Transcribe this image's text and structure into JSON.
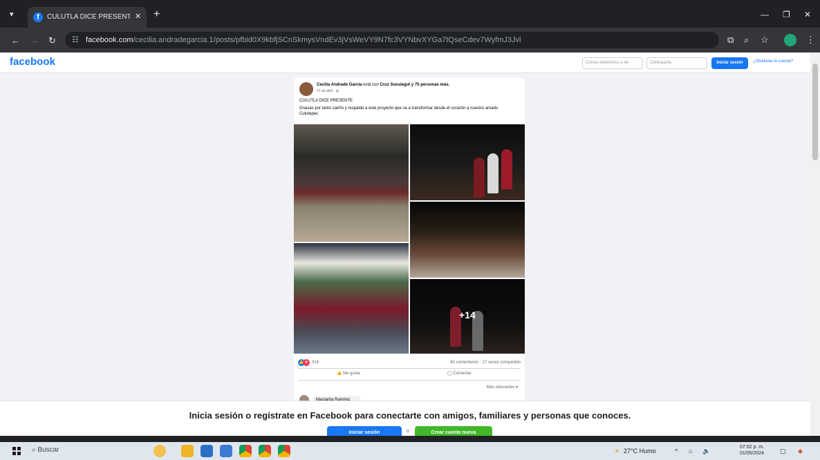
{
  "browser": {
    "tab_title": "CULUTLA DICE PRESENTE Gr...",
    "tab_close": "✕",
    "new_tab": "+",
    "url_host": "facebook.com",
    "url_path": "/cecilia.andradegarcia.1/posts/pfbid0X9kbfjSCnSkmysVndEv3jVsWeVY9N7fc3VYNbvXYGa7tQseCdev7WyfmJ3Jvl",
    "icons": [
      "menu-icon",
      "back-icon",
      "forward-icon",
      "reload-icon",
      "site-info-icon",
      "cast-icon",
      "zoom-icon",
      "star-icon",
      "profile-icon",
      "more-icon"
    ]
  },
  "header": {
    "logo": "facebook",
    "email_placeholder": "Correo electrónico o tel",
    "password_placeholder": "Contraseña",
    "login_label": "Iniciar sesión",
    "forgot_label": "¿Olvidaste la cuenta?"
  },
  "post": {
    "author": "Cecilia Andrade García",
    "with_text": " está con ",
    "tagged": "Cruz Sussiegut y 75 personas más.",
    "date": "21 de abril · ",
    "title": "CULUTLA DICE PRESENTE",
    "text": "Gracias por tanto cariño y respaldo a este proyecto que va a transformar desde el corazón a nuestro amado Culutepec.",
    "more_photos": "+14",
    "reaction_count": "319",
    "comments_shares": "60 comentarios · 27 veces compartido",
    "like_label": "Me gusta",
    "comment_label": "Comentar",
    "relevant_label": "Más relevantes ▾",
    "commenter": "Margarita Ramírez"
  },
  "banner": {
    "text": "Inicia sesión o regístrate en Facebook para conectarte con amigos, familiares y personas que conoces.",
    "login_label": "Iniciar sesión",
    "or_label": "o",
    "create_label": "Crear cuenta nueva"
  },
  "taskbar": {
    "search_label": "Buscar",
    "weather": "27°C Humo",
    "time": "07:02 p. m.",
    "date": "01/05/2024",
    "icons": [
      "windows-start-icon",
      "search-icon",
      "weather-widget-icon",
      "file-explorer-icon",
      "store-icon",
      "photos-icon",
      "chrome-icon",
      "chrome-icon",
      "chrome-icon"
    ]
  },
  "colors": {
    "facebook_blue": "#1877f2",
    "create_green": "#42b72a",
    "page_bg": "#f0f2f5"
  }
}
